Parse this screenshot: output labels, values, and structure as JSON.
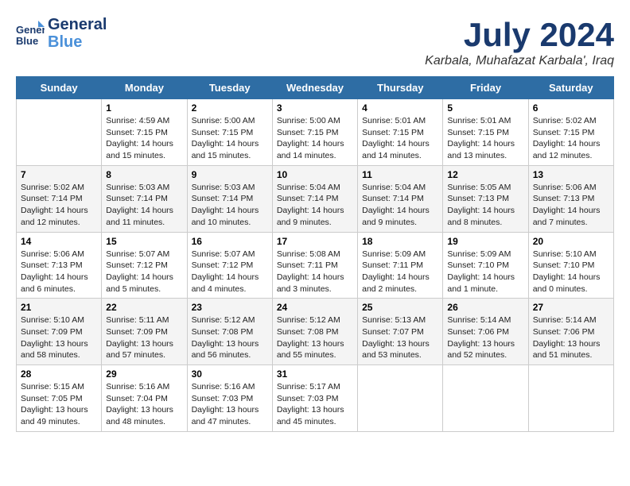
{
  "header": {
    "logo_line1": "General",
    "logo_line2": "Blue",
    "month": "July 2024",
    "location": "Karbala, Muhafazat Karbala', Iraq"
  },
  "weekdays": [
    "Sunday",
    "Monday",
    "Tuesday",
    "Wednesday",
    "Thursday",
    "Friday",
    "Saturday"
  ],
  "weeks": [
    [
      {
        "day": "",
        "info": ""
      },
      {
        "day": "1",
        "info": "Sunrise: 4:59 AM\nSunset: 7:15 PM\nDaylight: 14 hours\nand 15 minutes."
      },
      {
        "day": "2",
        "info": "Sunrise: 5:00 AM\nSunset: 7:15 PM\nDaylight: 14 hours\nand 15 minutes."
      },
      {
        "day": "3",
        "info": "Sunrise: 5:00 AM\nSunset: 7:15 PM\nDaylight: 14 hours\nand 14 minutes."
      },
      {
        "day": "4",
        "info": "Sunrise: 5:01 AM\nSunset: 7:15 PM\nDaylight: 14 hours\nand 14 minutes."
      },
      {
        "day": "5",
        "info": "Sunrise: 5:01 AM\nSunset: 7:15 PM\nDaylight: 14 hours\nand 13 minutes."
      },
      {
        "day": "6",
        "info": "Sunrise: 5:02 AM\nSunset: 7:15 PM\nDaylight: 14 hours\nand 12 minutes."
      }
    ],
    [
      {
        "day": "7",
        "info": "Sunrise: 5:02 AM\nSunset: 7:14 PM\nDaylight: 14 hours\nand 12 minutes."
      },
      {
        "day": "8",
        "info": "Sunrise: 5:03 AM\nSunset: 7:14 PM\nDaylight: 14 hours\nand 11 minutes."
      },
      {
        "day": "9",
        "info": "Sunrise: 5:03 AM\nSunset: 7:14 PM\nDaylight: 14 hours\nand 10 minutes."
      },
      {
        "day": "10",
        "info": "Sunrise: 5:04 AM\nSunset: 7:14 PM\nDaylight: 14 hours\nand 9 minutes."
      },
      {
        "day": "11",
        "info": "Sunrise: 5:04 AM\nSunset: 7:14 PM\nDaylight: 14 hours\nand 9 minutes."
      },
      {
        "day": "12",
        "info": "Sunrise: 5:05 AM\nSunset: 7:13 PM\nDaylight: 14 hours\nand 8 minutes."
      },
      {
        "day": "13",
        "info": "Sunrise: 5:06 AM\nSunset: 7:13 PM\nDaylight: 14 hours\nand 7 minutes."
      }
    ],
    [
      {
        "day": "14",
        "info": "Sunrise: 5:06 AM\nSunset: 7:13 PM\nDaylight: 14 hours\nand 6 minutes."
      },
      {
        "day": "15",
        "info": "Sunrise: 5:07 AM\nSunset: 7:12 PM\nDaylight: 14 hours\nand 5 minutes."
      },
      {
        "day": "16",
        "info": "Sunrise: 5:07 AM\nSunset: 7:12 PM\nDaylight: 14 hours\nand 4 minutes."
      },
      {
        "day": "17",
        "info": "Sunrise: 5:08 AM\nSunset: 7:11 PM\nDaylight: 14 hours\nand 3 minutes."
      },
      {
        "day": "18",
        "info": "Sunrise: 5:09 AM\nSunset: 7:11 PM\nDaylight: 14 hours\nand 2 minutes."
      },
      {
        "day": "19",
        "info": "Sunrise: 5:09 AM\nSunset: 7:10 PM\nDaylight: 14 hours\nand 1 minute."
      },
      {
        "day": "20",
        "info": "Sunrise: 5:10 AM\nSunset: 7:10 PM\nDaylight: 14 hours\nand 0 minutes."
      }
    ],
    [
      {
        "day": "21",
        "info": "Sunrise: 5:10 AM\nSunset: 7:09 PM\nDaylight: 13 hours\nand 58 minutes."
      },
      {
        "day": "22",
        "info": "Sunrise: 5:11 AM\nSunset: 7:09 PM\nDaylight: 13 hours\nand 57 minutes."
      },
      {
        "day": "23",
        "info": "Sunrise: 5:12 AM\nSunset: 7:08 PM\nDaylight: 13 hours\nand 56 minutes."
      },
      {
        "day": "24",
        "info": "Sunrise: 5:12 AM\nSunset: 7:08 PM\nDaylight: 13 hours\nand 55 minutes."
      },
      {
        "day": "25",
        "info": "Sunrise: 5:13 AM\nSunset: 7:07 PM\nDaylight: 13 hours\nand 53 minutes."
      },
      {
        "day": "26",
        "info": "Sunrise: 5:14 AM\nSunset: 7:06 PM\nDaylight: 13 hours\nand 52 minutes."
      },
      {
        "day": "27",
        "info": "Sunrise: 5:14 AM\nSunset: 7:06 PM\nDaylight: 13 hours\nand 51 minutes."
      }
    ],
    [
      {
        "day": "28",
        "info": "Sunrise: 5:15 AM\nSunset: 7:05 PM\nDaylight: 13 hours\nand 49 minutes."
      },
      {
        "day": "29",
        "info": "Sunrise: 5:16 AM\nSunset: 7:04 PM\nDaylight: 13 hours\nand 48 minutes."
      },
      {
        "day": "30",
        "info": "Sunrise: 5:16 AM\nSunset: 7:03 PM\nDaylight: 13 hours\nand 47 minutes."
      },
      {
        "day": "31",
        "info": "Sunrise: 5:17 AM\nSunset: 7:03 PM\nDaylight: 13 hours\nand 45 minutes."
      },
      {
        "day": "",
        "info": ""
      },
      {
        "day": "",
        "info": ""
      },
      {
        "day": "",
        "info": ""
      }
    ]
  ]
}
